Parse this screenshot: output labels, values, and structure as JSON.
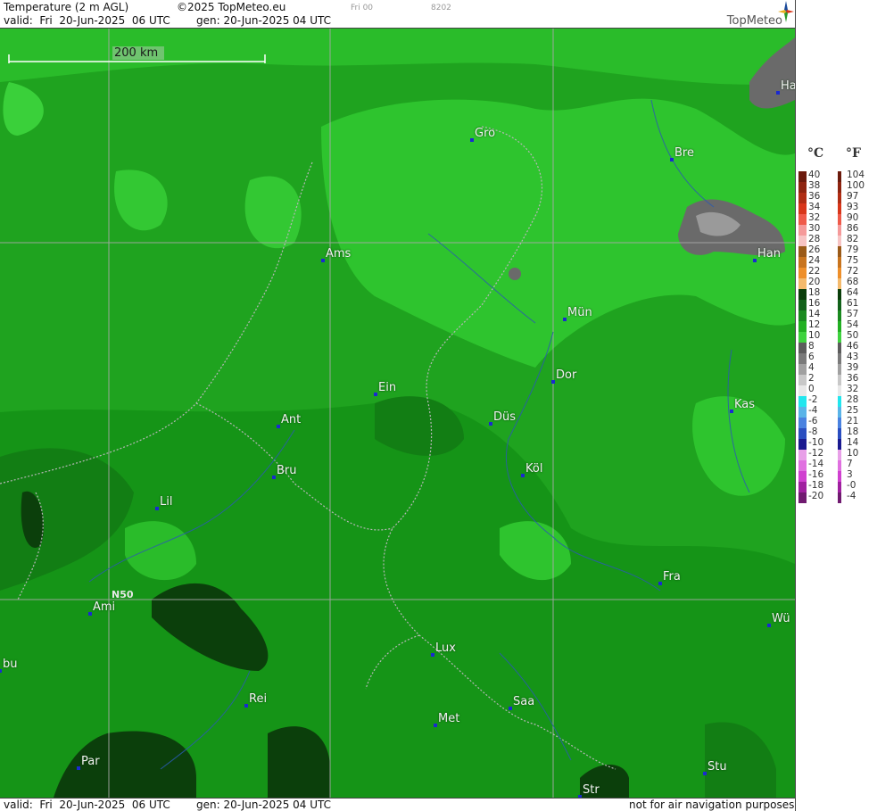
{
  "header": {
    "title": "Temperature (2 m AGL)",
    "copyright": "©2025 TopMeteo.eu",
    "valid_label": "valid:  Fri  20-Jun-2025  06 UTC",
    "gen_label": "gen: 20-Jun-2025 04 UTC",
    "frame": "Fri 00",
    "code": "8202",
    "logo": "TopMeteo"
  },
  "footer": {
    "valid_label": "valid:  Fri  20-Jun-2025  06 UTC",
    "gen_label": "gen: 20-Jun-2025 04 UTC",
    "disclaimer": "not for air navigation purposes"
  },
  "map": {
    "scale_label": "200 km",
    "latitude_label": "N50",
    "cities": [
      "Gro",
      "Bre",
      "Ha",
      "Ams",
      "Han",
      "Mün",
      "Ein",
      "Dor",
      "Ant",
      "Düs",
      "Kas",
      "Bru",
      "Köl",
      "Lil",
      "Fra",
      "Ami",
      "Wü",
      "Lux",
      "bu",
      "Rei",
      "Saa",
      "Met",
      "Par",
      "Stu",
      "Str"
    ]
  },
  "legend": {
    "celsius_unit": "°C",
    "fahrenheit_unit": "°F",
    "celsius": [
      "40",
      "38",
      "36",
      "34",
      "32",
      "30",
      "28",
      "26",
      "24",
      "22",
      "20",
      "18",
      "16",
      "14",
      "12",
      "10",
      "8",
      "6",
      "4",
      "2",
      "0",
      "-2",
      "-4",
      "-6",
      "-8",
      "-10",
      "-12",
      "-14",
      "-16",
      "-18",
      "-20"
    ],
    "fahrenheit": [
      "104",
      "100",
      "97",
      "93",
      "90",
      "86",
      "82",
      "79",
      "75",
      "72",
      "68",
      "64",
      "61",
      "57",
      "54",
      "50",
      "46",
      "43",
      "39",
      "36",
      "32",
      "28",
      "25",
      "21",
      "18",
      "14",
      "10",
      "7",
      "3",
      "-0",
      "-4"
    ],
    "colors": [
      "#6b1a0c",
      "#8e2410",
      "#b02d14",
      "#d8361a",
      "#ef5a4a",
      "#f59a9a",
      "#f7c4c4",
      "#9a5a18",
      "#c8741e",
      "#ee8f2a",
      "#f4ba6c",
      "#0a3e0a",
      "#12621a",
      "#1a8a1f",
      "#22b022",
      "#3fd33f",
      "#5c5c5c",
      "#7a7a7a",
      "#a0a0a0",
      "#c8c8c8",
      "#e8e8e8",
      "#22e6ee",
      "#5ab4e8",
      "#4a82e0",
      "#2a4ec0",
      "#1a1a90",
      "#e8a0e8",
      "#e070e0",
      "#d040d0",
      "#a020a0",
      "#701a70"
    ]
  }
}
